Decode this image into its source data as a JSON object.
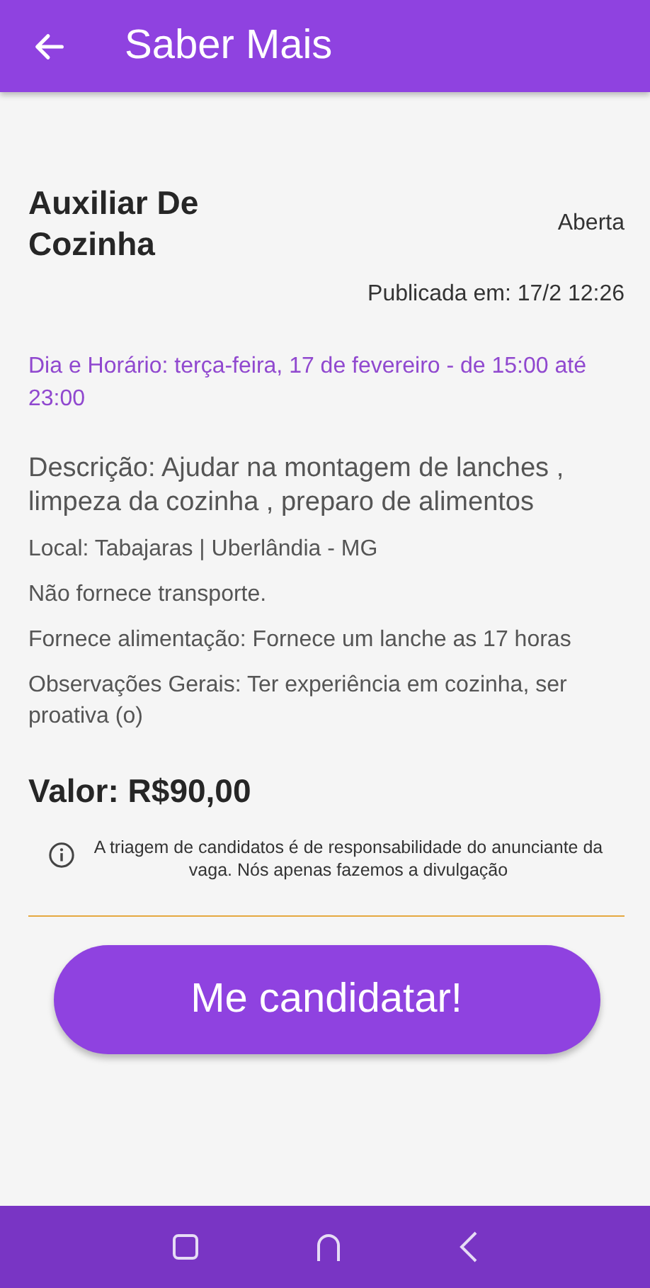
{
  "app_bar": {
    "title": "Saber Mais"
  },
  "job": {
    "title": "Auxiliar De Cozinha",
    "status": "Aberta",
    "published": "Publicada em: 17/2 12:26",
    "schedule": "Dia e Horário: terça-feira, 17 de fevereiro - de 15:00 até 23:00",
    "description": "Descrição: Ajudar na montagem de lanches , limpeza da cozinha , preparo de alimentos",
    "details": [
      "Local: Tabajaras  | Uberlândia - MG",
      "Não fornece transporte.",
      "Fornece alimentação: Fornece um lanche as 17 horas",
      "Observações Gerais: Ter experiência em cozinha, ser proativa (o)"
    ],
    "value": "Valor: R$90,00",
    "notice": "A triagem de candidatos é de responsabilidade do anunciante da vaga. Nós apenas fazemos a divulgação"
  },
  "apply_button": "Me candidatar!"
}
